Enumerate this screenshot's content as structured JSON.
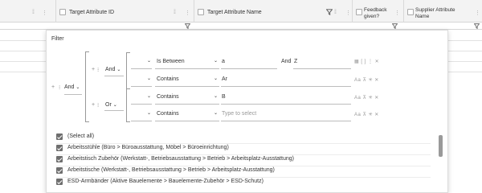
{
  "grid": {
    "columns": [
      {
        "label": "Target Attribute ID"
      },
      {
        "label": "Target Attribute Name"
      },
      {
        "label": "Feedback given?"
      },
      {
        "label": "Supplier Attribute Name"
      }
    ]
  },
  "filter": {
    "title": "Filter",
    "root_operator": "And",
    "group1_operator": "And",
    "group2_operator": "Or",
    "conditions": [
      {
        "operator": "Is Between",
        "value": "a",
        "and_label": "And",
        "value2": "Z"
      },
      {
        "operator": "Contains",
        "value": "Ar"
      },
      {
        "operator": "Contains",
        "value": "B"
      },
      {
        "operator": "Contains",
        "value": "",
        "placeholder": "Type to select"
      }
    ],
    "checklist": [
      {
        "label": "(Select all)",
        "checked": true
      },
      {
        "label": "Arbeitsstühle (Büro > Büroausstattung, Möbel > Büroeinrichtung)",
        "checked": true
      },
      {
        "label": "Arbeitstisch Zubehör (Werkstatt-, Betriebsausstattung > Betrieb > Arbeitsplatz-Ausstattung)",
        "checked": true
      },
      {
        "label": "Arbeitstische (Werkstatt-, Betriebsausstattung > Betrieb > Arbeitsplatz-Ausstattung)",
        "checked": true
      },
      {
        "label": "ESD-Armbänder (Aktive Bauelemente > Bauelemente-Zubehör > ESD-Schutz)",
        "checked": true
      }
    ]
  }
}
